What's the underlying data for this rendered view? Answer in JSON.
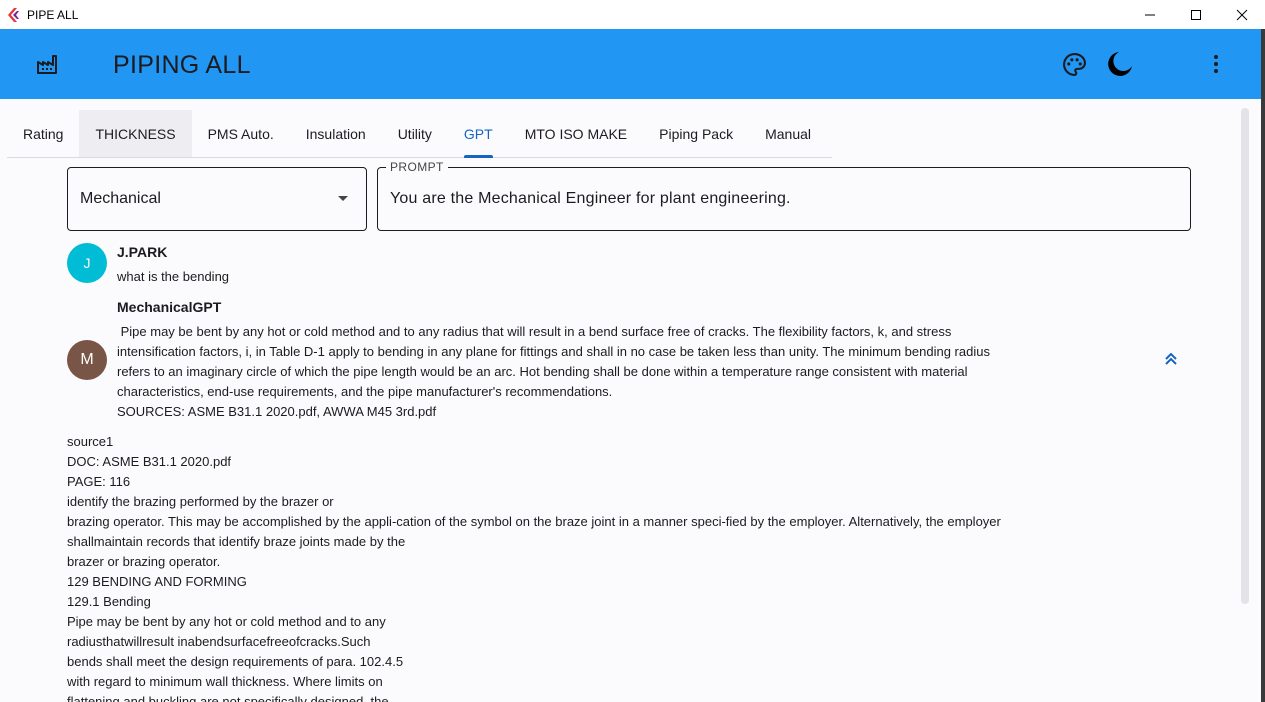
{
  "window": {
    "title": "PIPE ALL"
  },
  "appbar": {
    "title": "PIPING ALL",
    "icons": [
      "factory-icon",
      "palette-icon",
      "moon-icon",
      "more-vert-icon"
    ],
    "color": "#2196f3"
  },
  "tabs": [
    {
      "label": "Rating"
    },
    {
      "label": "THICKNESS"
    },
    {
      "label": "PMS Auto."
    },
    {
      "label": "Insulation"
    },
    {
      "label": "Utility"
    },
    {
      "label": "GPT"
    },
    {
      "label": "MTO ISO MAKE"
    },
    {
      "label": "Piping Pack"
    },
    {
      "label": "Manual"
    }
  ],
  "active_tab": "GPT",
  "role_select": {
    "value": "Mechanical"
  },
  "prompt": {
    "label": "PROMPT",
    "value": "You are the Mechanical Engineer for plant engineering."
  },
  "chat": {
    "user": {
      "initial": "J",
      "name": "J.PARK",
      "message": "what is the bending",
      "avatar_color": "#00bcd4"
    },
    "bot": {
      "initial": "M",
      "name": "MechanicalGPT",
      "avatar_color": "#795548",
      "lines": [
        " Pipe may be bent by any hot or cold method and to any radius that will result in a bend surface free of cracks. The flexibility factors, k, and stress",
        "intensification factors, i, in Table D-1 apply to bending in any plane for fittings and shall in no case be taken less than unity. The minimum bending radius",
        "refers to an imaginary circle of which the pipe length would be an arc. Hot bending shall be done within a temperature range consistent with material",
        "characteristics, end-use requirements, and the pipe manufacturer's recommendations.",
        "SOURCES: ASME B31.1 2020.pdf, AWWA M45 3rd.pdf"
      ]
    }
  },
  "sources": [
    "source1",
    "DOC: ASME B31.1 2020.pdf",
    "PAGE: 116",
    "identify the brazing performed by the brazer or",
    "brazing operator. This may be accomplished by the appli-cation of the symbol on the braze joint in a manner speci-fied by the employer. Alternatively, the employer",
    "shallmaintain records that identify braze joints made by the",
    "brazer or brazing operator.",
    "129 BENDING AND FORMING",
    "129.1 Bending",
    "Pipe may be bent by any hot or cold method and to any",
    "radiusthatwillresult inabendsurfacefreeofcracks.Such",
    "bends shall meet the design requirements of para. 102.4.5",
    "with regard to minimum wall thickness. Where limits on",
    "flattening and buckling are not specifically designed, the"
  ]
}
